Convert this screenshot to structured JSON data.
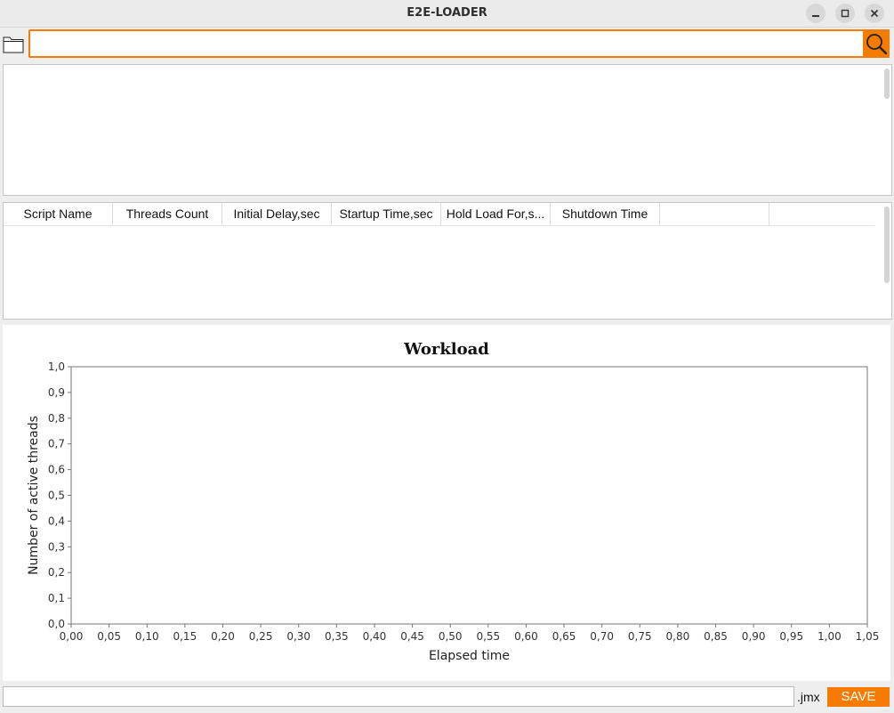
{
  "window": {
    "title": "E2E-LOADER"
  },
  "search": {
    "path_value": "",
    "placeholder": ""
  },
  "table": {
    "columns": [
      "Script Name",
      "Threads Count",
      "Initial Delay,sec",
      "Startup Time,sec",
      "Hold Load For,s...",
      "Shutdown Time",
      "",
      ""
    ],
    "rows": []
  },
  "chart_data": {
    "type": "line",
    "title": "Workload",
    "xlabel": "Elapsed time",
    "ylabel": "Number of active threads",
    "xlim": [
      0,
      1.05
    ],
    "ylim": [
      0,
      1.0
    ],
    "xticks": [
      "0,00",
      "0,05",
      "0,10",
      "0,15",
      "0,20",
      "0,25",
      "0,30",
      "0,35",
      "0,40",
      "0,45",
      "0,50",
      "0,55",
      "0,60",
      "0,65",
      "0,70",
      "0,75",
      "0,80",
      "0,85",
      "0,90",
      "0,95",
      "1,00",
      "1,05"
    ],
    "yticks": [
      "0,0",
      "0,1",
      "0,2",
      "0,3",
      "0,4",
      "0,5",
      "0,6",
      "0,7",
      "0,8",
      "0,9",
      "1,0"
    ],
    "series": [],
    "grid": false
  },
  "footer": {
    "filename_value": "",
    "extension": ".jmx",
    "save_label": "SAVE"
  },
  "colors": {
    "accent": "#f57c00"
  }
}
